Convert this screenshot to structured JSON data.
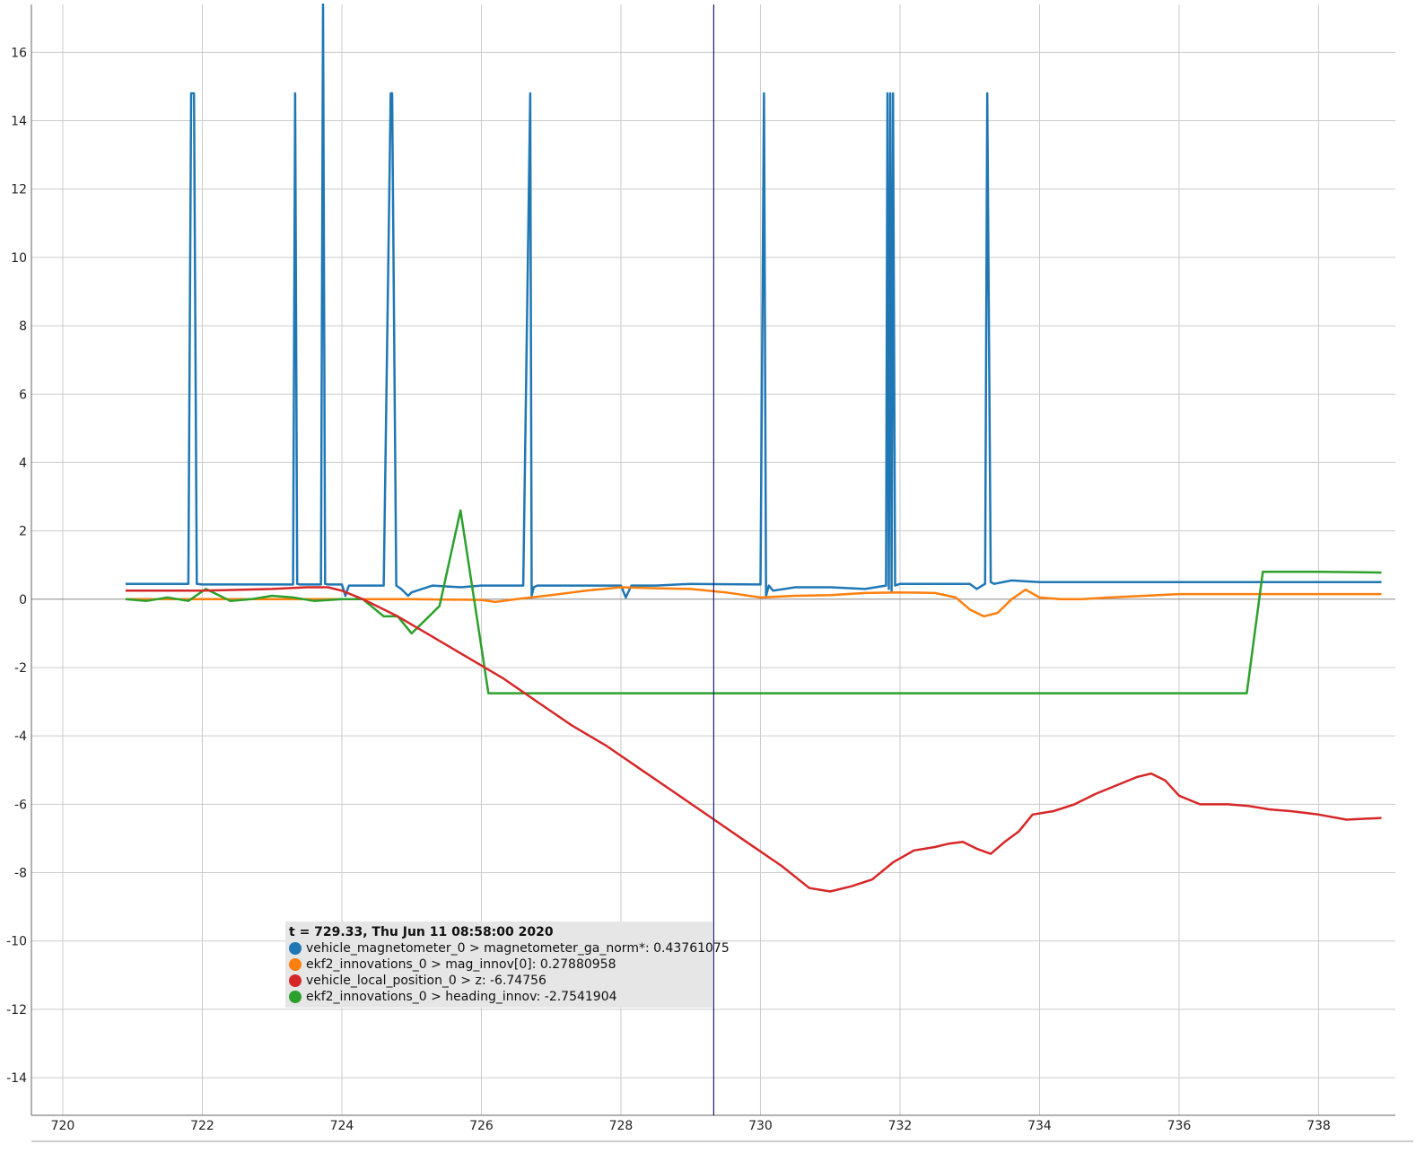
{
  "chart_data": {
    "type": "line",
    "title": "",
    "xlabel": "",
    "ylabel": "",
    "xlim": [
      719.55,
      739.1
    ],
    "ylim": [
      -15.1,
      17.4
    ],
    "grid": true,
    "x_ticks": [
      720,
      722,
      724,
      726,
      728,
      730,
      732,
      734,
      736,
      738
    ],
    "x_tick_labels": [
      "720",
      "722",
      "724",
      "726",
      "728",
      "730",
      "732",
      "734",
      "736",
      "738"
    ],
    "y_ticks": [
      16,
      14,
      12,
      10,
      8,
      6,
      4,
      2,
      0,
      -2,
      -4,
      -6,
      -8,
      -10,
      -12,
      -14
    ],
    "y_tick_labels": [
      "16",
      "14",
      "12",
      "10",
      "8",
      "6",
      "4",
      "2",
      "0",
      "-2",
      "-4",
      "-6",
      "-8",
      "-10",
      "-12",
      "-14"
    ],
    "cursor_x": 729.33,
    "legend_placement": "bottom-center",
    "series": [
      {
        "name": "vehicle_magnetometer_0 > magnetometer_ga_norm*",
        "color": "#1f77b4",
        "x": [
          720.9,
          721.8,
          721.84,
          721.88,
          721.92,
          722.0,
          723.3,
          723.33,
          723.36,
          723.4,
          723.7,
          723.73,
          723.76,
          723.8,
          724.0,
          724.05,
          724.1,
          724.6,
          724.7,
          724.72,
          724.78,
          724.85,
          724.95,
          725.0,
          725.3,
          725.7,
          726.0,
          726.6,
          726.7,
          726.72,
          726.75,
          726.8,
          727.0,
          727.3,
          728.0,
          728.07,
          728.15,
          728.5,
          729.0,
          729.3,
          730.0,
          730.05,
          730.08,
          730.12,
          730.18,
          730.5,
          731.0,
          731.5,
          731.8,
          731.82,
          731.84,
          731.86,
          731.88,
          731.9,
          731.93,
          732.0,
          733.0,
          733.1,
          733.22,
          733.25,
          733.3,
          733.35,
          733.6,
          734.0,
          735.0,
          736.0,
          737.0,
          738.0,
          738.9
        ],
        "y": [
          0.45,
          0.45,
          14.8,
          14.8,
          0.45,
          0.43,
          0.43,
          14.8,
          0.45,
          0.43,
          0.43,
          17.4,
          0.45,
          0.43,
          0.43,
          0.1,
          0.4,
          0.4,
          14.8,
          14.8,
          0.4,
          0.3,
          0.1,
          0.2,
          0.4,
          0.35,
          0.4,
          0.4,
          14.8,
          0.1,
          0.35,
          0.4,
          0.4,
          0.4,
          0.4,
          0.05,
          0.4,
          0.4,
          0.45,
          0.44,
          0.43,
          14.8,
          0.1,
          0.4,
          0.25,
          0.35,
          0.35,
          0.3,
          0.4,
          14.8,
          0.3,
          14.8,
          0.2,
          14.8,
          0.4,
          0.45,
          0.45,
          0.3,
          0.45,
          14.8,
          0.5,
          0.45,
          0.55,
          0.5,
          0.5,
          0.5,
          0.5,
          0.5,
          0.5
        ]
      },
      {
        "name": "ekf2_innovations_0 > mag_innov[0]",
        "color": "#ff7f0e",
        "x": [
          720.9,
          722.0,
          724.0,
          725.0,
          726.0,
          726.2,
          726.5,
          727.0,
          727.5,
          728.0,
          728.5,
          729.0,
          729.5,
          730.0,
          730.5,
          731.0,
          731.5,
          732.0,
          732.5,
          732.8,
          733.0,
          733.2,
          733.4,
          733.6,
          733.8,
          734.0,
          734.3,
          734.6,
          735.0,
          735.5,
          736.0,
          736.5,
          737.0,
          738.0,
          738.9
        ],
        "y": [
          0.0,
          0.0,
          0.0,
          0.0,
          -0.02,
          -0.08,
          0.0,
          0.12,
          0.25,
          0.35,
          0.32,
          0.3,
          0.2,
          0.05,
          0.1,
          0.12,
          0.18,
          0.2,
          0.18,
          0.05,
          -0.3,
          -0.5,
          -0.4,
          0.0,
          0.28,
          0.05,
          0.0,
          0.0,
          0.05,
          0.1,
          0.15,
          0.15,
          0.15,
          0.15,
          0.15
        ]
      },
      {
        "name": "vehicle_local_position_0 > z",
        "color": "#d62728",
        "x": [
          720.9,
          722.0,
          723.0,
          723.5,
          723.8,
          724.0,
          724.3,
          724.8,
          725.3,
          725.8,
          726.3,
          726.8,
          727.3,
          727.8,
          728.3,
          728.8,
          729.3,
          729.8,
          730.3,
          730.7,
          731.0,
          731.3,
          731.6,
          731.9,
          732.2,
          732.5,
          732.7,
          732.9,
          733.1,
          733.3,
          733.5,
          733.7,
          733.9,
          734.2,
          734.5,
          734.8,
          735.1,
          735.4,
          735.6,
          735.8,
          736.0,
          736.3,
          736.7,
          737.0,
          737.3,
          737.6,
          738.0,
          738.4,
          738.9
        ],
        "y": [
          0.25,
          0.25,
          0.3,
          0.35,
          0.35,
          0.25,
          0.0,
          -0.5,
          -1.1,
          -1.7,
          -2.3,
          -3.0,
          -3.7,
          -4.3,
          -5.0,
          -5.7,
          -6.4,
          -7.1,
          -7.8,
          -8.45,
          -8.55,
          -8.4,
          -8.2,
          -7.7,
          -7.35,
          -7.25,
          -7.15,
          -7.1,
          -7.3,
          -7.45,
          -7.1,
          -6.8,
          -6.3,
          -6.2,
          -6.0,
          -5.7,
          -5.45,
          -5.2,
          -5.1,
          -5.3,
          -5.75,
          -6.0,
          -6.0,
          -6.05,
          -6.15,
          -6.2,
          -6.3,
          -6.45,
          -6.4
        ]
      },
      {
        "name": "ekf2_innovations_0 > heading_innov",
        "color": "#2ca02c",
        "x": [
          720.9,
          721.2,
          721.5,
          721.8,
          722.05,
          722.4,
          722.7,
          723.0,
          723.3,
          723.6,
          724.0,
          724.3,
          724.6,
          724.8,
          725.0,
          725.2,
          725.4,
          725.7,
          726.1,
          727.0,
          728.0,
          729.0,
          730.0,
          731.0,
          732.0,
          733.0,
          734.0,
          735.0,
          736.0,
          736.97,
          737.2,
          738.0,
          738.9
        ],
        "y": [
          0.0,
          -0.05,
          0.05,
          -0.05,
          0.3,
          -0.05,
          0.0,
          0.1,
          0.05,
          -0.05,
          0.0,
          0.0,
          -0.5,
          -0.5,
          -1.0,
          -0.6,
          -0.2,
          2.6,
          -2.75,
          -2.75,
          -2.75,
          -2.75,
          -2.75,
          -2.75,
          -2.75,
          -2.75,
          -2.75,
          -2.75,
          -2.75,
          -2.75,
          0.8,
          0.8,
          0.78
        ]
      }
    ]
  },
  "legend": {
    "title": "t = 729.33, Thu Jun 11 08:58:00 2020",
    "items": [
      {
        "text": "vehicle_magnetometer_0 > magnetometer_ga_norm*: 0.43761075",
        "color": "#1f77b4"
      },
      {
        "text": "ekf2_innovations_0 > mag_innov[0]: 0.27880958",
        "color": "#ff7f0e"
      },
      {
        "text": "vehicle_local_position_0 > z: -6.74756",
        "color": "#d62728"
      },
      {
        "text": "ekf2_innovations_0 > heading_innov: -2.7541904",
        "color": "#2ca02c"
      }
    ]
  }
}
